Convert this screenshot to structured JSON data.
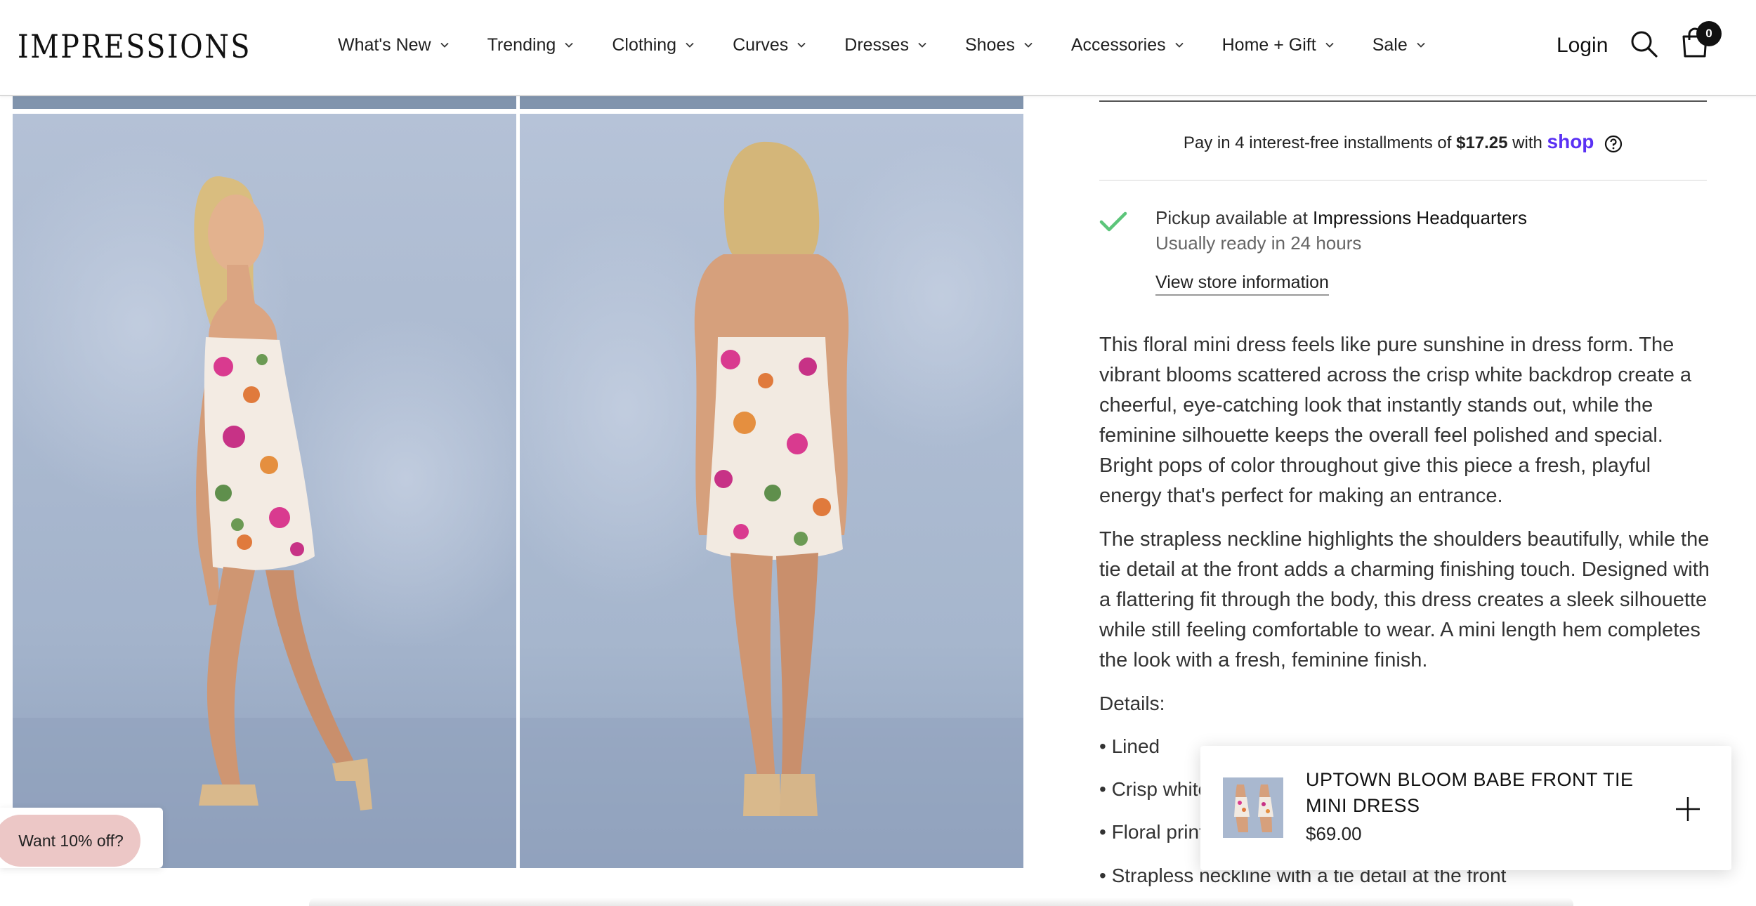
{
  "brand": {
    "logo_text": "IMPRESSIONS"
  },
  "nav": {
    "items": [
      {
        "label": "What's New"
      },
      {
        "label": "Trending"
      },
      {
        "label": "Clothing"
      },
      {
        "label": "Curves"
      },
      {
        "label": "Dresses"
      },
      {
        "label": "Shoes"
      },
      {
        "label": "Accessories"
      },
      {
        "label": "Home + Gift"
      },
      {
        "label": "Sale"
      }
    ],
    "login_label": "Login",
    "cart_count": "0",
    "icons": [
      "search-icon",
      "cart-icon",
      "chevron-down-icon"
    ]
  },
  "product": {
    "installments": {
      "prefix": "Pay in 4 interest-free installments of",
      "amount": "$17.25",
      "with": "with",
      "provider": "shop"
    },
    "pickup": {
      "label": "Pickup available at",
      "location": "Impressions Headquarters",
      "ready": "Usually ready in 24 hours",
      "link": "View store information"
    },
    "description": [
      "This floral mini dress feels like pure sunshine in dress form. The vibrant blooms scattered across the crisp white backdrop create a cheerful, eye-catching look that instantly stands out, while the feminine silhouette keeps the overall feel polished and special. Bright pops of color throughout give this piece a fresh, playful energy that's perfect for making an entrance.",
      "The strapless neckline highlights the shoulders beautifully, while the tie detail at the front adds a charming finishing touch. Designed with a flattering fit through the body, this dress creates a sleek silhouette while still feeling comfortable to wear. A mini length hem completes the look with a fresh, feminine finish."
    ],
    "details_label": "Details:",
    "details": [
      "• Lined",
      "• Crisp white",
      "• Floral print",
      "• Strapless neckline with a tie detail at the front"
    ]
  },
  "sticky": {
    "title": "UPTOWN BLOOM BABE FRONT TIE MINI DRESS",
    "price": "$69.00"
  },
  "promo": {
    "label": "Want 10% off?"
  },
  "colors": {
    "shop_purple": "#5a31f4",
    "check_green": "#5cc57a",
    "promo_pink": "#ecc7c6",
    "backdrop_blue": "#a9b8cf"
  }
}
